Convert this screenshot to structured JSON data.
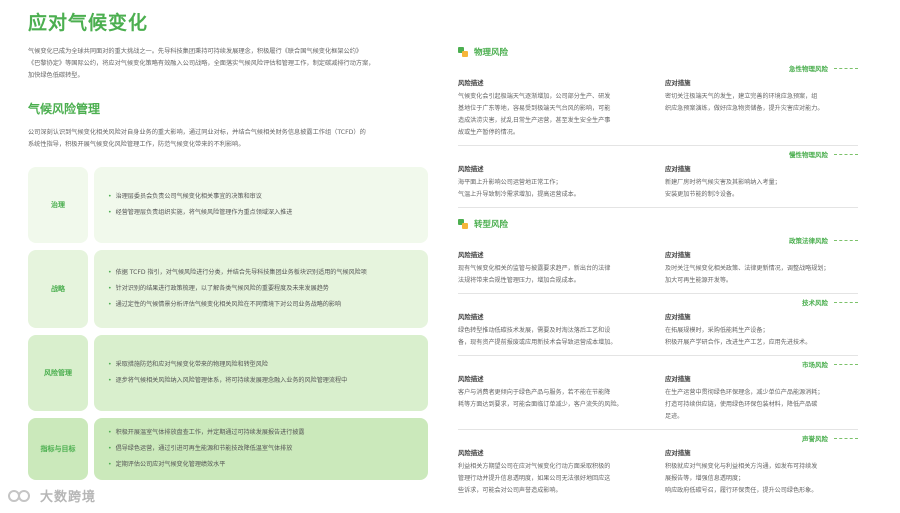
{
  "left": {
    "title": "应对气候变化",
    "intro_lines": [
      "气候变化已成为全球共同面对的重大挑战之一。先导科技集团秉持可持续发展理念，积极履行《联合国气候变化框架公约》",
      "《巴黎协定》等国际公约，将应对气候变化策略有效融入公司战略，全面落实气候风险评估和管理工作，制定碳减排行动方案，",
      "加快绿色低碳转型。"
    ],
    "section_title": "气候风险管理",
    "section_intro_lines": [
      "公司深刻认识到气候变化相关风险对自身业务的重大影响，通过同业对标，并结合气候相关财务信息披露工作组（TCFD）的",
      "系统性指导，积极开展气候变化风险管理工作，防范气候变化带来的不利影响。"
    ],
    "rows": [
      {
        "label": "治理",
        "items": [
          "治理层委员会负责公司气候变化相关事宜的决策和审议",
          "经营管理层负责组织实施，将气候风险管理作为重点领域深入推进"
        ]
      },
      {
        "label": "战略",
        "items": [
          "依据 TCFD 指引，对气候风险进行分类，并结合先导科技集团业务板块识别适用的气候风险项",
          "针对识别的结果进行政策梳理，以了解各类气候风险的重要程度及未来发展趋势",
          "通过定性的气候情景分析评估气候变化相关风险在不同情境下对公司业务战略的影响"
        ]
      },
      {
        "label": "风险管理",
        "items": [
          "采取措施防范和应对气候变化带来的物理风险和转型风险",
          "逐步将气候相关风险纳入风险管理体系，将可持续发展理念融入业务的风险管理流程中"
        ]
      },
      {
        "label": "指标与目标",
        "items": [
          "积极开展温室气体排放盘查工作，并定期通过可持续发展报告进行披露",
          "倡导绿色运营，通过引进可再生能源和节能技改降低温室气体排放",
          "定期评估公司应对气候变化管理绩效水平"
        ]
      }
    ]
  },
  "right": {
    "physical_title": "物理风险",
    "transition_title": "转型风险",
    "risk_label": "风险描述",
    "response_label": "应对措施",
    "physical": [
      {
        "tag": "急性物理风险",
        "risk": [
          "气候变化会引起极端天气逐渐增加，公司部分生产、研发",
          "基地位于广东等地，容易受到极端天气台风的影响，可能",
          "造成洪涝灾害，扰乱日常生产运营，甚至发生安全生产事",
          "故或生产暂停的情况。"
        ],
        "response": [
          "密切关注极端天气的发生，建立完善的环境应急预案，组",
          "织应急预案演练，做好应急物资储备，提升灾害应对能力。"
        ]
      },
      {
        "tag": "慢性物理风险",
        "risk": [
          "海平面上升影响公司运营地正常工作；",
          "气温上升导致制冷需求增加，提高运营成本。"
        ],
        "response": [
          "新建厂房时将气候灾害及其影响纳入考量；",
          "安装更加节能的制冷设备。"
        ]
      }
    ],
    "transition": [
      {
        "tag": "政策法律风险",
        "risk": [
          "现有气候变化相关的监管与披露要求趋严，新出台的法律",
          "法规将带来合规性管理压力，增加合规成本。"
        ],
        "response": [
          "及时关注气候变化相关政策、法律更新情况，调整战略规划；",
          "加大可再生能源开发等。"
        ]
      },
      {
        "tag": "技术风险",
        "risk": [
          "绿色转型推动低碳技术发展，需要及时淘汰落后工艺和设",
          "备，现有资产提前报废或应用新技术会导致运营成本增加。"
        ],
        "response": [
          "在拓展规模时，采购低能耗生产设备；",
          "积极开展产学研合作，改进生产工艺，应用先进技术。"
        ]
      },
      {
        "tag": "市场风险",
        "risk": [
          "客户与消费者更倾向于绿色产品与服务，若不能在节能降",
          "耗等方面达到要求，可能会面临订单减少，客户流失的风险。"
        ],
        "response": [
          "在生产运营中贯彻绿色环保理念，减少单位产品能源消耗；",
          "打造可持续供应链，使用绿色环保包装材料，降低产品碳",
          "足迹。"
        ]
      },
      {
        "tag": "声誉风险",
        "risk": [
          "利益相关方期望公司在应对气候变化行动方面采取积极的",
          "管理行动并提升信息透明度，如果公司无法很好地回应这",
          "些诉求，可能会对公司声誉造成影响。"
        ],
        "response": [
          "积极就应对气候变化与利益相关方沟通，如发布可持续发",
          "展报告等，增强信息透明度；",
          "响应政府低碳号召，履行环保责任，提升公司绿色形象。"
        ]
      }
    ]
  },
  "watermark": {
    "text": "大数跨境"
  },
  "colors": {
    "accent": "#4caf50",
    "secondary": "#f6b53a"
  }
}
